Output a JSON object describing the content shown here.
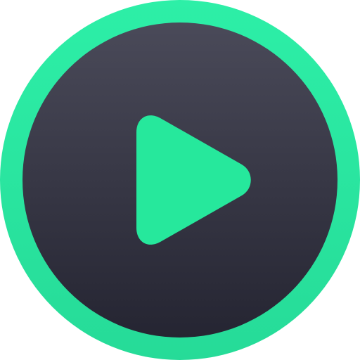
{
  "icon": {
    "name": "play-icon",
    "colors": {
      "ring": "#26DB98",
      "ring_highlight": "#2DEFA7",
      "disc_top": "#4A4A59",
      "disc_bottom": "#252532",
      "triangle": "#26E89C"
    }
  }
}
